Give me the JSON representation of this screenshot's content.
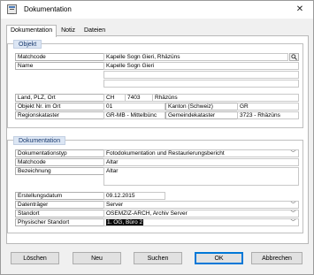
{
  "window": {
    "title": "Dokumentation"
  },
  "tabs": [
    "Dokumentation",
    "Notiz",
    "Dateien"
  ],
  "objekt": {
    "legend": "Objekt",
    "matchcode_label": "Matchcode",
    "matchcode_value": "Kapelle Sogn Gieri, Rhäzüns",
    "name_label": "Name",
    "name_value": "Kapelle Sogn Gieri",
    "land_label": "Land, PLZ, Ort",
    "land_value": "CH",
    "plz_value": "7403",
    "ort_value": "Rhäzüns",
    "objekt_nr_label": "Objekt Nr. im Ort",
    "objekt_nr_value": "01",
    "kanton_label": "Kanton (Schweiz)",
    "kanton_value": "GR",
    "regionskataster_label": "Regionskataster",
    "regionskataster_value": "GR-MB - Mittelbünc",
    "gemeindekataster_label": "Gemeindekataster",
    "gemeindekataster_value": "3723 - Rhäzüns"
  },
  "dokumentation": {
    "legend": "Dokumentation",
    "typ_label": "Dokumentationstyp",
    "typ_value": "Fotodokumentation und Restaurierungsbericht",
    "matchcode_label": "Matchcode",
    "matchcode_value": "Altar",
    "bezeichnung_label": "Bezeichnung",
    "bezeichnung_value": "Altar",
    "datum_label": "Erstellungsdatum",
    "datum_value": "09.12.2015",
    "datentraeger_label": "Datenträger",
    "datentraeger_value": "Server",
    "standort_label": "Standort",
    "standort_value": "OSEMZIZ-ARCH, Archiv Server",
    "phys_standort_label": "Physischer Standort",
    "phys_standort_value": "1. OG, Büro 2"
  },
  "buttons": {
    "loeschen": "Löschen",
    "neu": "Neu",
    "suchen": "Suchen",
    "ok": "OK",
    "abbrechen": "Abbrechen"
  },
  "icons": {
    "close": "close-icon",
    "search": "search-icon",
    "dropdown": "chevron-down-icon",
    "app": "app-icon"
  }
}
